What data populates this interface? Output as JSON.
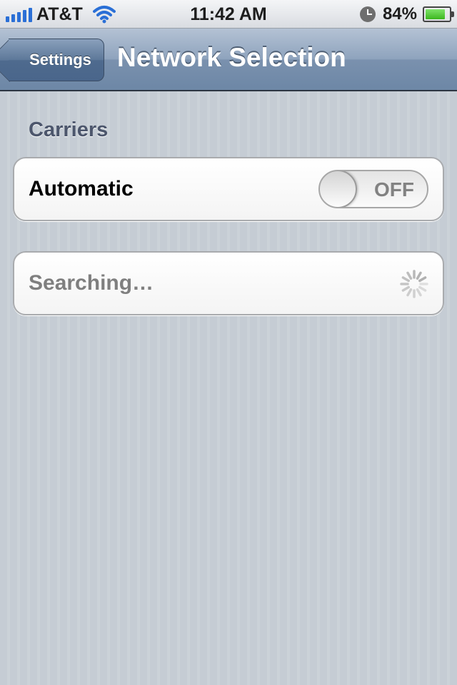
{
  "status_bar": {
    "carrier": "AT&T",
    "time": "11:42 AM",
    "battery_percent": "84%",
    "battery_level": 0.84,
    "signal_bars": 5,
    "icons": [
      "signal-icon",
      "wifi-icon",
      "alarm-clock-icon",
      "battery-icon"
    ]
  },
  "nav": {
    "back_label": "Settings",
    "title": "Network Selection"
  },
  "section": {
    "header": "Carriers"
  },
  "automatic": {
    "label": "Automatic",
    "toggle_label": "OFF",
    "toggle_on": false
  },
  "search": {
    "label": "Searching…",
    "icon": "activity-spinner-icon"
  },
  "colors": {
    "nav_bar": "#6d87a6",
    "background": "#c5ccd4",
    "section_header": "#4c566c"
  }
}
